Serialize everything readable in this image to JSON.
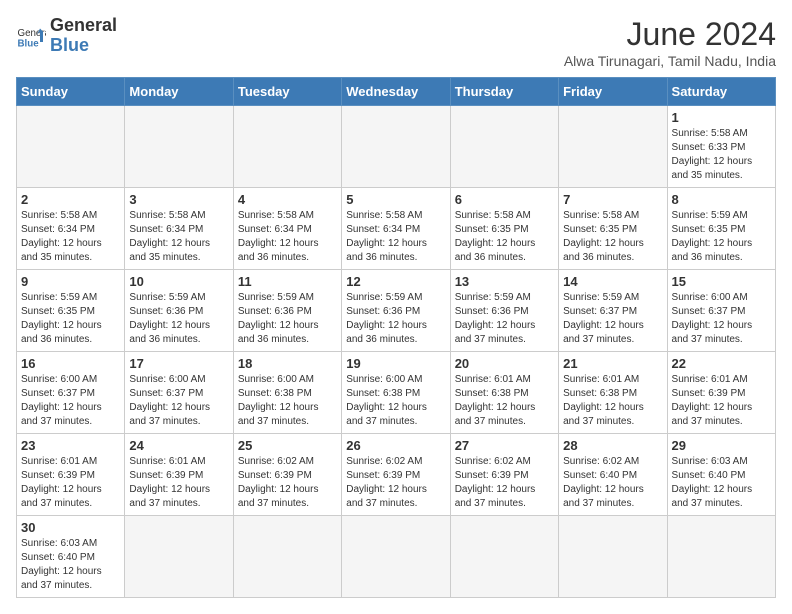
{
  "header": {
    "logo_general": "General",
    "logo_blue": "Blue",
    "title": "June 2024",
    "subtitle": "Alwa Tirunagari, Tamil Nadu, India"
  },
  "weekdays": [
    "Sunday",
    "Monday",
    "Tuesday",
    "Wednesday",
    "Thursday",
    "Friday",
    "Saturday"
  ],
  "weeks": [
    [
      {
        "day": "",
        "info": ""
      },
      {
        "day": "",
        "info": ""
      },
      {
        "day": "",
        "info": ""
      },
      {
        "day": "",
        "info": ""
      },
      {
        "day": "",
        "info": ""
      },
      {
        "day": "",
        "info": ""
      },
      {
        "day": "1",
        "info": "Sunrise: 5:58 AM\nSunset: 6:33 PM\nDaylight: 12 hours\nand 35 minutes."
      }
    ],
    [
      {
        "day": "2",
        "info": "Sunrise: 5:58 AM\nSunset: 6:34 PM\nDaylight: 12 hours\nand 35 minutes."
      },
      {
        "day": "3",
        "info": "Sunrise: 5:58 AM\nSunset: 6:34 PM\nDaylight: 12 hours\nand 35 minutes."
      },
      {
        "day": "4",
        "info": "Sunrise: 5:58 AM\nSunset: 6:34 PM\nDaylight: 12 hours\nand 36 minutes."
      },
      {
        "day": "5",
        "info": "Sunrise: 5:58 AM\nSunset: 6:34 PM\nDaylight: 12 hours\nand 36 minutes."
      },
      {
        "day": "6",
        "info": "Sunrise: 5:58 AM\nSunset: 6:35 PM\nDaylight: 12 hours\nand 36 minutes."
      },
      {
        "day": "7",
        "info": "Sunrise: 5:58 AM\nSunset: 6:35 PM\nDaylight: 12 hours\nand 36 minutes."
      },
      {
        "day": "8",
        "info": "Sunrise: 5:59 AM\nSunset: 6:35 PM\nDaylight: 12 hours\nand 36 minutes."
      }
    ],
    [
      {
        "day": "9",
        "info": "Sunrise: 5:59 AM\nSunset: 6:35 PM\nDaylight: 12 hours\nand 36 minutes."
      },
      {
        "day": "10",
        "info": "Sunrise: 5:59 AM\nSunset: 6:36 PM\nDaylight: 12 hours\nand 36 minutes."
      },
      {
        "day": "11",
        "info": "Sunrise: 5:59 AM\nSunset: 6:36 PM\nDaylight: 12 hours\nand 36 minutes."
      },
      {
        "day": "12",
        "info": "Sunrise: 5:59 AM\nSunset: 6:36 PM\nDaylight: 12 hours\nand 36 minutes."
      },
      {
        "day": "13",
        "info": "Sunrise: 5:59 AM\nSunset: 6:36 PM\nDaylight: 12 hours\nand 37 minutes."
      },
      {
        "day": "14",
        "info": "Sunrise: 5:59 AM\nSunset: 6:37 PM\nDaylight: 12 hours\nand 37 minutes."
      },
      {
        "day": "15",
        "info": "Sunrise: 6:00 AM\nSunset: 6:37 PM\nDaylight: 12 hours\nand 37 minutes."
      }
    ],
    [
      {
        "day": "16",
        "info": "Sunrise: 6:00 AM\nSunset: 6:37 PM\nDaylight: 12 hours\nand 37 minutes."
      },
      {
        "day": "17",
        "info": "Sunrise: 6:00 AM\nSunset: 6:37 PM\nDaylight: 12 hours\nand 37 minutes."
      },
      {
        "day": "18",
        "info": "Sunrise: 6:00 AM\nSunset: 6:38 PM\nDaylight: 12 hours\nand 37 minutes."
      },
      {
        "day": "19",
        "info": "Sunrise: 6:00 AM\nSunset: 6:38 PM\nDaylight: 12 hours\nand 37 minutes."
      },
      {
        "day": "20",
        "info": "Sunrise: 6:01 AM\nSunset: 6:38 PM\nDaylight: 12 hours\nand 37 minutes."
      },
      {
        "day": "21",
        "info": "Sunrise: 6:01 AM\nSunset: 6:38 PM\nDaylight: 12 hours\nand 37 minutes."
      },
      {
        "day": "22",
        "info": "Sunrise: 6:01 AM\nSunset: 6:39 PM\nDaylight: 12 hours\nand 37 minutes."
      }
    ],
    [
      {
        "day": "23",
        "info": "Sunrise: 6:01 AM\nSunset: 6:39 PM\nDaylight: 12 hours\nand 37 minutes."
      },
      {
        "day": "24",
        "info": "Sunrise: 6:01 AM\nSunset: 6:39 PM\nDaylight: 12 hours\nand 37 minutes."
      },
      {
        "day": "25",
        "info": "Sunrise: 6:02 AM\nSunset: 6:39 PM\nDaylight: 12 hours\nand 37 minutes."
      },
      {
        "day": "26",
        "info": "Sunrise: 6:02 AM\nSunset: 6:39 PM\nDaylight: 12 hours\nand 37 minutes."
      },
      {
        "day": "27",
        "info": "Sunrise: 6:02 AM\nSunset: 6:39 PM\nDaylight: 12 hours\nand 37 minutes."
      },
      {
        "day": "28",
        "info": "Sunrise: 6:02 AM\nSunset: 6:40 PM\nDaylight: 12 hours\nand 37 minutes."
      },
      {
        "day": "29",
        "info": "Sunrise: 6:03 AM\nSunset: 6:40 PM\nDaylight: 12 hours\nand 37 minutes."
      }
    ],
    [
      {
        "day": "30",
        "info": "Sunrise: 6:03 AM\nSunset: 6:40 PM\nDaylight: 12 hours\nand 37 minutes."
      },
      {
        "day": "",
        "info": ""
      },
      {
        "day": "",
        "info": ""
      },
      {
        "day": "",
        "info": ""
      },
      {
        "day": "",
        "info": ""
      },
      {
        "day": "",
        "info": ""
      },
      {
        "day": "",
        "info": ""
      }
    ]
  ]
}
